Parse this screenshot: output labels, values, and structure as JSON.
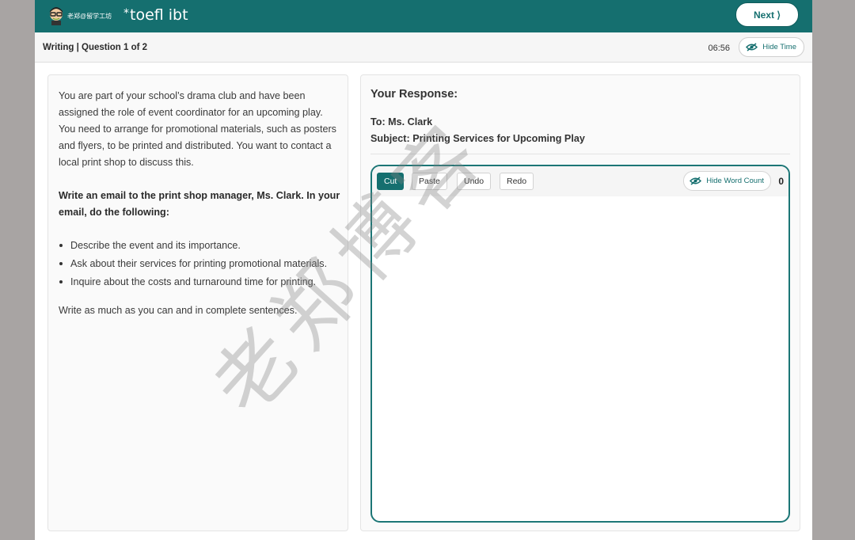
{
  "header": {
    "badge_text": "老郑@留学工坊",
    "logo_star": "*",
    "logo_text": "toefl ibt",
    "next_label": "Next ⟩"
  },
  "subbar": {
    "section_title": "Writing | Question 1 of 2",
    "timer": "06:56",
    "hide_time_label": "Hide Time"
  },
  "prompt": {
    "intro": "You are part of your school’s drama club and have been assigned the role of event coordinator for an upcoming play. You need to arrange for promotional materials, such as posters and flyers, to be printed and distributed. You want to contact a local print shop to discuss this.",
    "task": "Write an email to the print shop manager, Ms. Clark. In your email, do the following:",
    "bullets": [
      "Describe the event and its importance.",
      "Ask about their services for printing promotional materials.",
      "Inquire about the costs and turnaround time for printing."
    ],
    "closing": "Write as much as you can and in complete sentences."
  },
  "response": {
    "title": "Your Response:",
    "to_label": "To:",
    "to_value": "Ms. Clark",
    "subject_label": "Subject:",
    "subject_value": "Printing Services for Upcoming Play",
    "text": ""
  },
  "editor": {
    "cut": "Cut",
    "paste": "Paste",
    "undo": "Undo",
    "redo": "Redo",
    "hide_word_count": "Hide Word Count",
    "word_count": "0"
  },
  "watermark": "老郑博客",
  "colors": {
    "brand_teal": "#156f6f",
    "page_bg": "#a8a4a3"
  },
  "icons": {
    "hide_time": "eye-slash-icon",
    "hide_word_count": "eye-slash-icon",
    "avatar": "cartoon-avatar-icon"
  }
}
